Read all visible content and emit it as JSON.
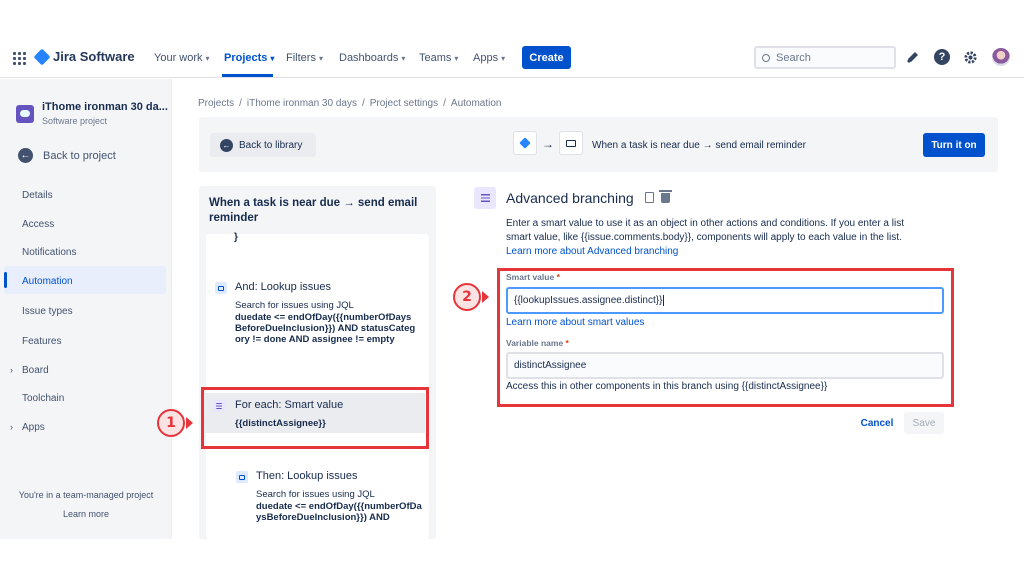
{
  "nav": {
    "brand": "Jira Software",
    "items": [
      {
        "label": "Your work"
      },
      {
        "label": "Projects"
      },
      {
        "label": "Filters"
      },
      {
        "label": "Dashboards"
      },
      {
        "label": "Teams"
      },
      {
        "label": "Apps"
      }
    ],
    "active": "Projects",
    "create_label": "Create",
    "search_placeholder": "Search"
  },
  "sidebar": {
    "project_name": "iThome ironman 30 da...",
    "project_type": "Software project",
    "back_label": "Back to project",
    "items": [
      {
        "label": "Details",
        "expandable": false
      },
      {
        "label": "Access",
        "expandable": false
      },
      {
        "label": "Notifications",
        "expandable": false
      },
      {
        "label": "Automation",
        "expandable": false,
        "active": true
      },
      {
        "label": "Issue types",
        "expandable": false
      },
      {
        "label": "Features",
        "expandable": false
      },
      {
        "label": "Board",
        "expandable": true
      },
      {
        "label": "Toolchain",
        "expandable": false
      },
      {
        "label": "Apps",
        "expandable": true
      }
    ],
    "team_note": "You're in a team-managed project",
    "learn_more": "Learn more"
  },
  "breadcrumb": [
    "Projects",
    "iThome ironman 30 days",
    "Project settings",
    "Automation"
  ],
  "rule_header": {
    "back_label": "Back to library",
    "rule_title": "When a task is near due → send email reminder",
    "turn_on_label": "Turn it on"
  },
  "rule_panel": {
    "title": "When a task is near due → send email reminder",
    "fragment": "}",
    "components": [
      {
        "title": "And: Lookup issues",
        "desc": "Search for issues using JQL",
        "code": "duedate <= endOfDay({{numberOfDaysBeforeDueInclusion}}) AND statusCategory != done AND assignee != empty"
      },
      {
        "title": "For each: Smart value",
        "code": "{{distinctAssignee}}"
      },
      {
        "title": "Then: Lookup issues",
        "desc": "Search for issues using JQL",
        "code": "duedate <= endOfDay({{numberOfDaysBeforeDueInclusion}}) AND"
      }
    ]
  },
  "config": {
    "title": "Advanced branching",
    "desc_text": "Enter a smart value to use it as an object in other actions and conditions. If you enter a list smart value, like {{issue.comments.body}}, components will apply to each value in the list. ",
    "desc_link": "Learn more about Advanced branching",
    "smart_value_label": "Smart value",
    "smart_value": "{{lookupIssues.assignee.distinct}}",
    "smart_link": "Learn more about smart values",
    "variable_label": "Variable name",
    "variable_value": "distinctAssignee",
    "helper": "Access this in other components in this branch using {{distinctAssignee}}",
    "required_mark": "*",
    "cancel_label": "Cancel",
    "save_label": "Save"
  },
  "annotations": {
    "badge1": "1",
    "badge2": "2",
    "color": "#e5343a"
  },
  "colors": {
    "brand_blue": "#0052cc",
    "sidebar_bg": "#f4f5f7"
  }
}
